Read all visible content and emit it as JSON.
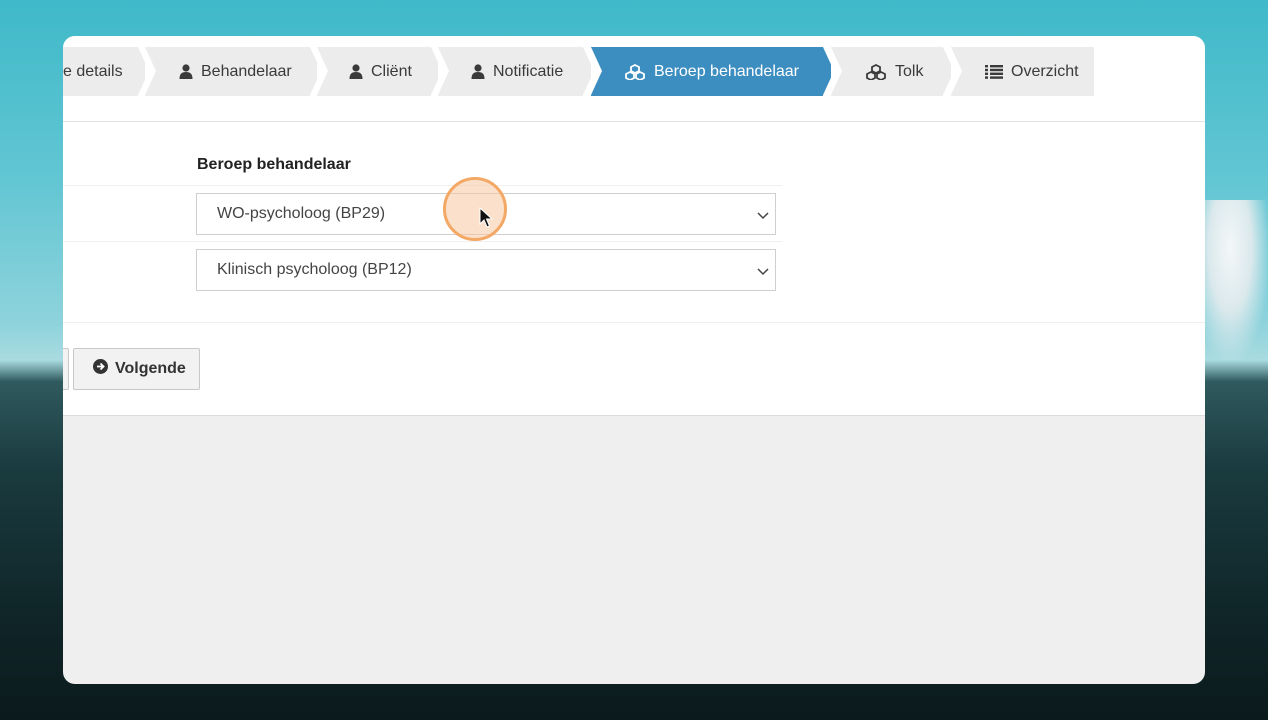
{
  "wizard": {
    "steps": [
      {
        "label": "e details",
        "icon": "none",
        "active": false
      },
      {
        "label": "Behandelaar",
        "icon": "user-icon",
        "active": false
      },
      {
        "label": "Cliënt",
        "icon": "user-icon",
        "active": false
      },
      {
        "label": "Notificatie",
        "icon": "user-icon",
        "active": false
      },
      {
        "label": "Beroep behandelaar",
        "icon": "cubes-icon",
        "active": true
      },
      {
        "label": "Tolk",
        "icon": "cubes-icon",
        "active": false
      },
      {
        "label": "Overzicht",
        "icon": "list-icon",
        "active": false
      }
    ],
    "active_color": "#3d8ec0"
  },
  "form": {
    "section_label": "Beroep behandelaar",
    "select1_value": "WO-psycholoog (BP29)",
    "select2_value": "Klinisch psycholoog (BP12)"
  },
  "buttons": {
    "next_label": "Volgende"
  }
}
